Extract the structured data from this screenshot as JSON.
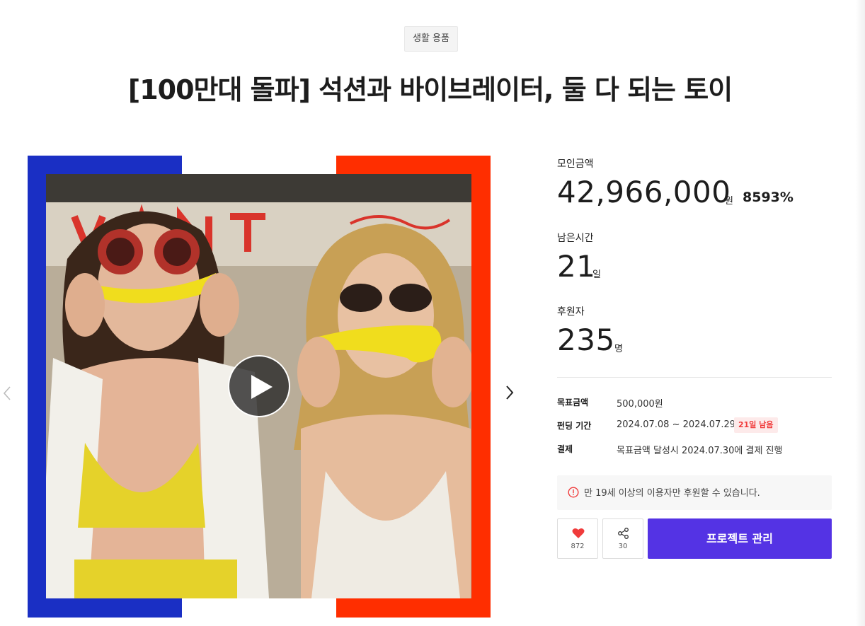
{
  "category": "생활 용품",
  "title": "[100만대 돌파] 석션과 바이브레이터, 둘 다 되는 토이",
  "stats": {
    "raised_label": "모인금액",
    "raised_value": "42,966,000",
    "raised_unit": "원",
    "raised_percent": "8593%",
    "time_label": "남은시간",
    "time_value": "21",
    "time_unit": "일",
    "backers_label": "후원자",
    "backers_value": "235",
    "backers_unit": "명"
  },
  "info": {
    "goal_label": "목표금액",
    "goal_value": "500,000원",
    "period_label": "펀딩 기간",
    "period_value": "2024.07.08 ~ 2024.07.29",
    "period_badge": "21일 남음",
    "payment_label": "결제",
    "payment_value": "목표금액 달성시 2024.07.30에 결제 진행"
  },
  "notice": "만 19세 이상의 이용자만 후원할 수 있습니다.",
  "actions": {
    "like_count": "872",
    "share_count": "30",
    "manage_label": "프로젝트 관리"
  },
  "colors": {
    "accent": "#5433e4",
    "blue_block": "#1a2fc4",
    "red_block": "#ff2e00",
    "badge_red": "#f03b3b",
    "heart": "#f03b3b"
  },
  "icons": [
    "chevron-left-icon",
    "chevron-right-icon",
    "play-icon",
    "info-icon",
    "heart-icon",
    "share-icon"
  ]
}
